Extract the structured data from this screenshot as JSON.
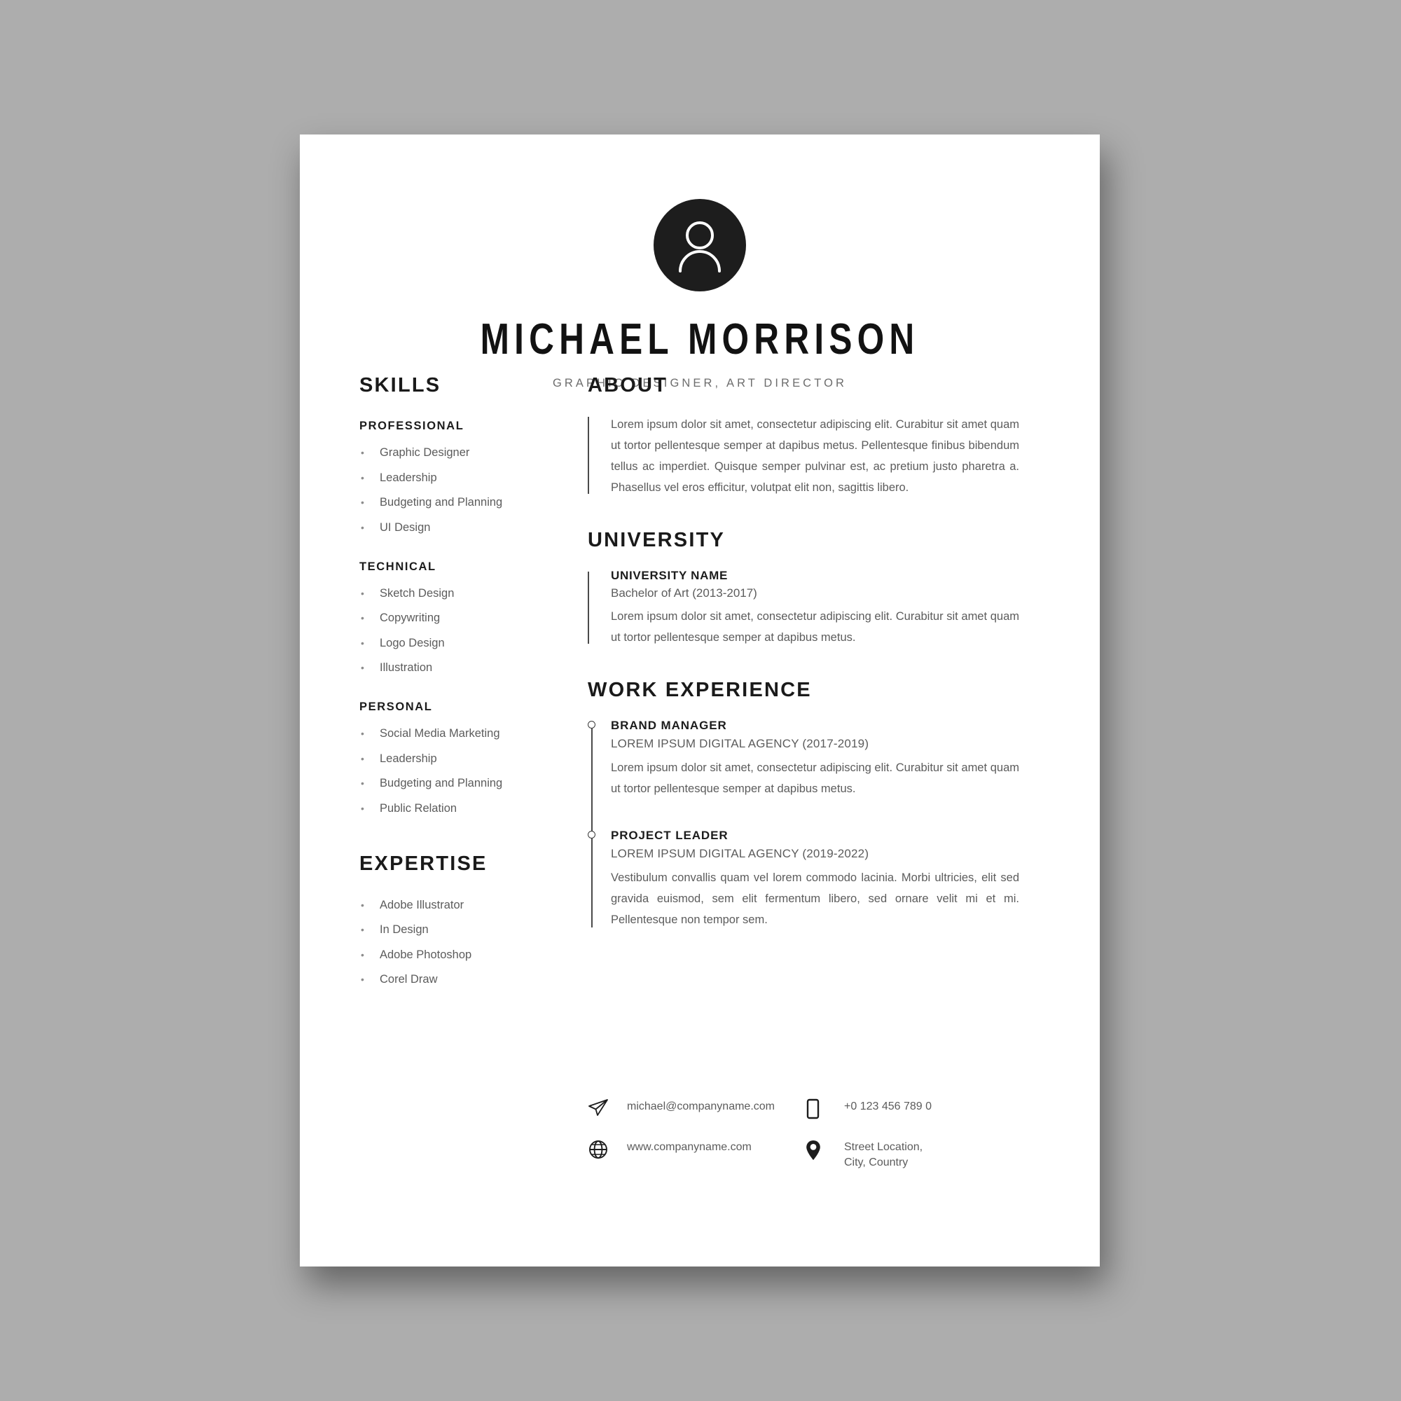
{
  "header": {
    "avatar_icon": "person-avatar-icon",
    "name": "MICHAEL MORRISON",
    "title": "GRAPHIC DESIGNER, ART DIRECTOR"
  },
  "skills": {
    "section_title": "SKILLS",
    "groups": [
      {
        "label": "PROFESSIONAL",
        "items": [
          "Graphic Designer",
          "Leadership",
          "Budgeting and Planning",
          "UI Design"
        ]
      },
      {
        "label": "TECHNICAL",
        "items": [
          "Sketch Design",
          "Copywriting",
          "Logo Design",
          "Illustration"
        ]
      },
      {
        "label": "PERSONAL",
        "items": [
          "Social Media Marketing",
          "Leadership",
          "Budgeting and Planning",
          "Public Relation"
        ]
      }
    ],
    "bullet": "•"
  },
  "expertise": {
    "section_title": "EXPERTISE",
    "items": [
      "Adobe Illustrator",
      "In Design",
      "Adobe Photoshop",
      "Corel Draw"
    ],
    "bullet": "•"
  },
  "about": {
    "section_title": "ABOUT",
    "text": "Lorem ipsum dolor sit amet, consectetur adipiscing elit. Curabitur sit amet quam ut tortor pellentesque semper at dapibus metus. Pellentesque finibus bibendum tellus ac imperdiet. Quisque semper pulvinar est, ac pretium justo pharetra a. Phasellus vel eros efficitur, volutpat elit non, sagittis libero."
  },
  "university": {
    "section_title": "UNIVERSITY",
    "entry": {
      "name": "UNIVERSITY NAME",
      "degree": "Bachelor of Art  (2013-2017)",
      "description": "Lorem ipsum dolor sit amet, consectetur adipiscing elit. Curabitur sit amet quam ut tortor pellentesque semper at dapibus metus."
    }
  },
  "work_experience": {
    "section_title": "WORK EXPERIENCE",
    "jobs": [
      {
        "role": "BRAND MANAGER",
        "company": "LOREM IPSUM DIGITAL AGENCY (2017-2019)",
        "description": "Lorem ipsum dolor sit amet, consectetur adipiscing elit. Curabitur sit amet quam ut tortor pellentesque semper at dapibus metus."
      },
      {
        "role": "PROJECT LEADER",
        "company": "LOREM IPSUM DIGITAL AGENCY (2019-2022)",
        "description": "Vestibulum convallis quam vel lorem commodo lacinia. Morbi ultricies, elit sed gravida euismod, sem elit fermentum libero, sed ornare velit mi et mi. Pellentesque non tempor sem."
      }
    ]
  },
  "contacts": {
    "email": {
      "icon": "paper-plane-icon",
      "value": "michael@companyname.com"
    },
    "phone": {
      "icon": "phone-icon",
      "value": "+0 123 456 789 0"
    },
    "website": {
      "icon": "globe-icon",
      "value": "www.companyname.com"
    },
    "location": {
      "icon": "location-pin-icon",
      "line1": "Street Location,",
      "line2": "City, Country"
    }
  },
  "colors": {
    "page_background": "#adadad",
    "sheet": "#ffffff",
    "heading": "#1a1a1a",
    "body_text": "#5c5c5c",
    "accent_dark": "#1d1d1d"
  }
}
